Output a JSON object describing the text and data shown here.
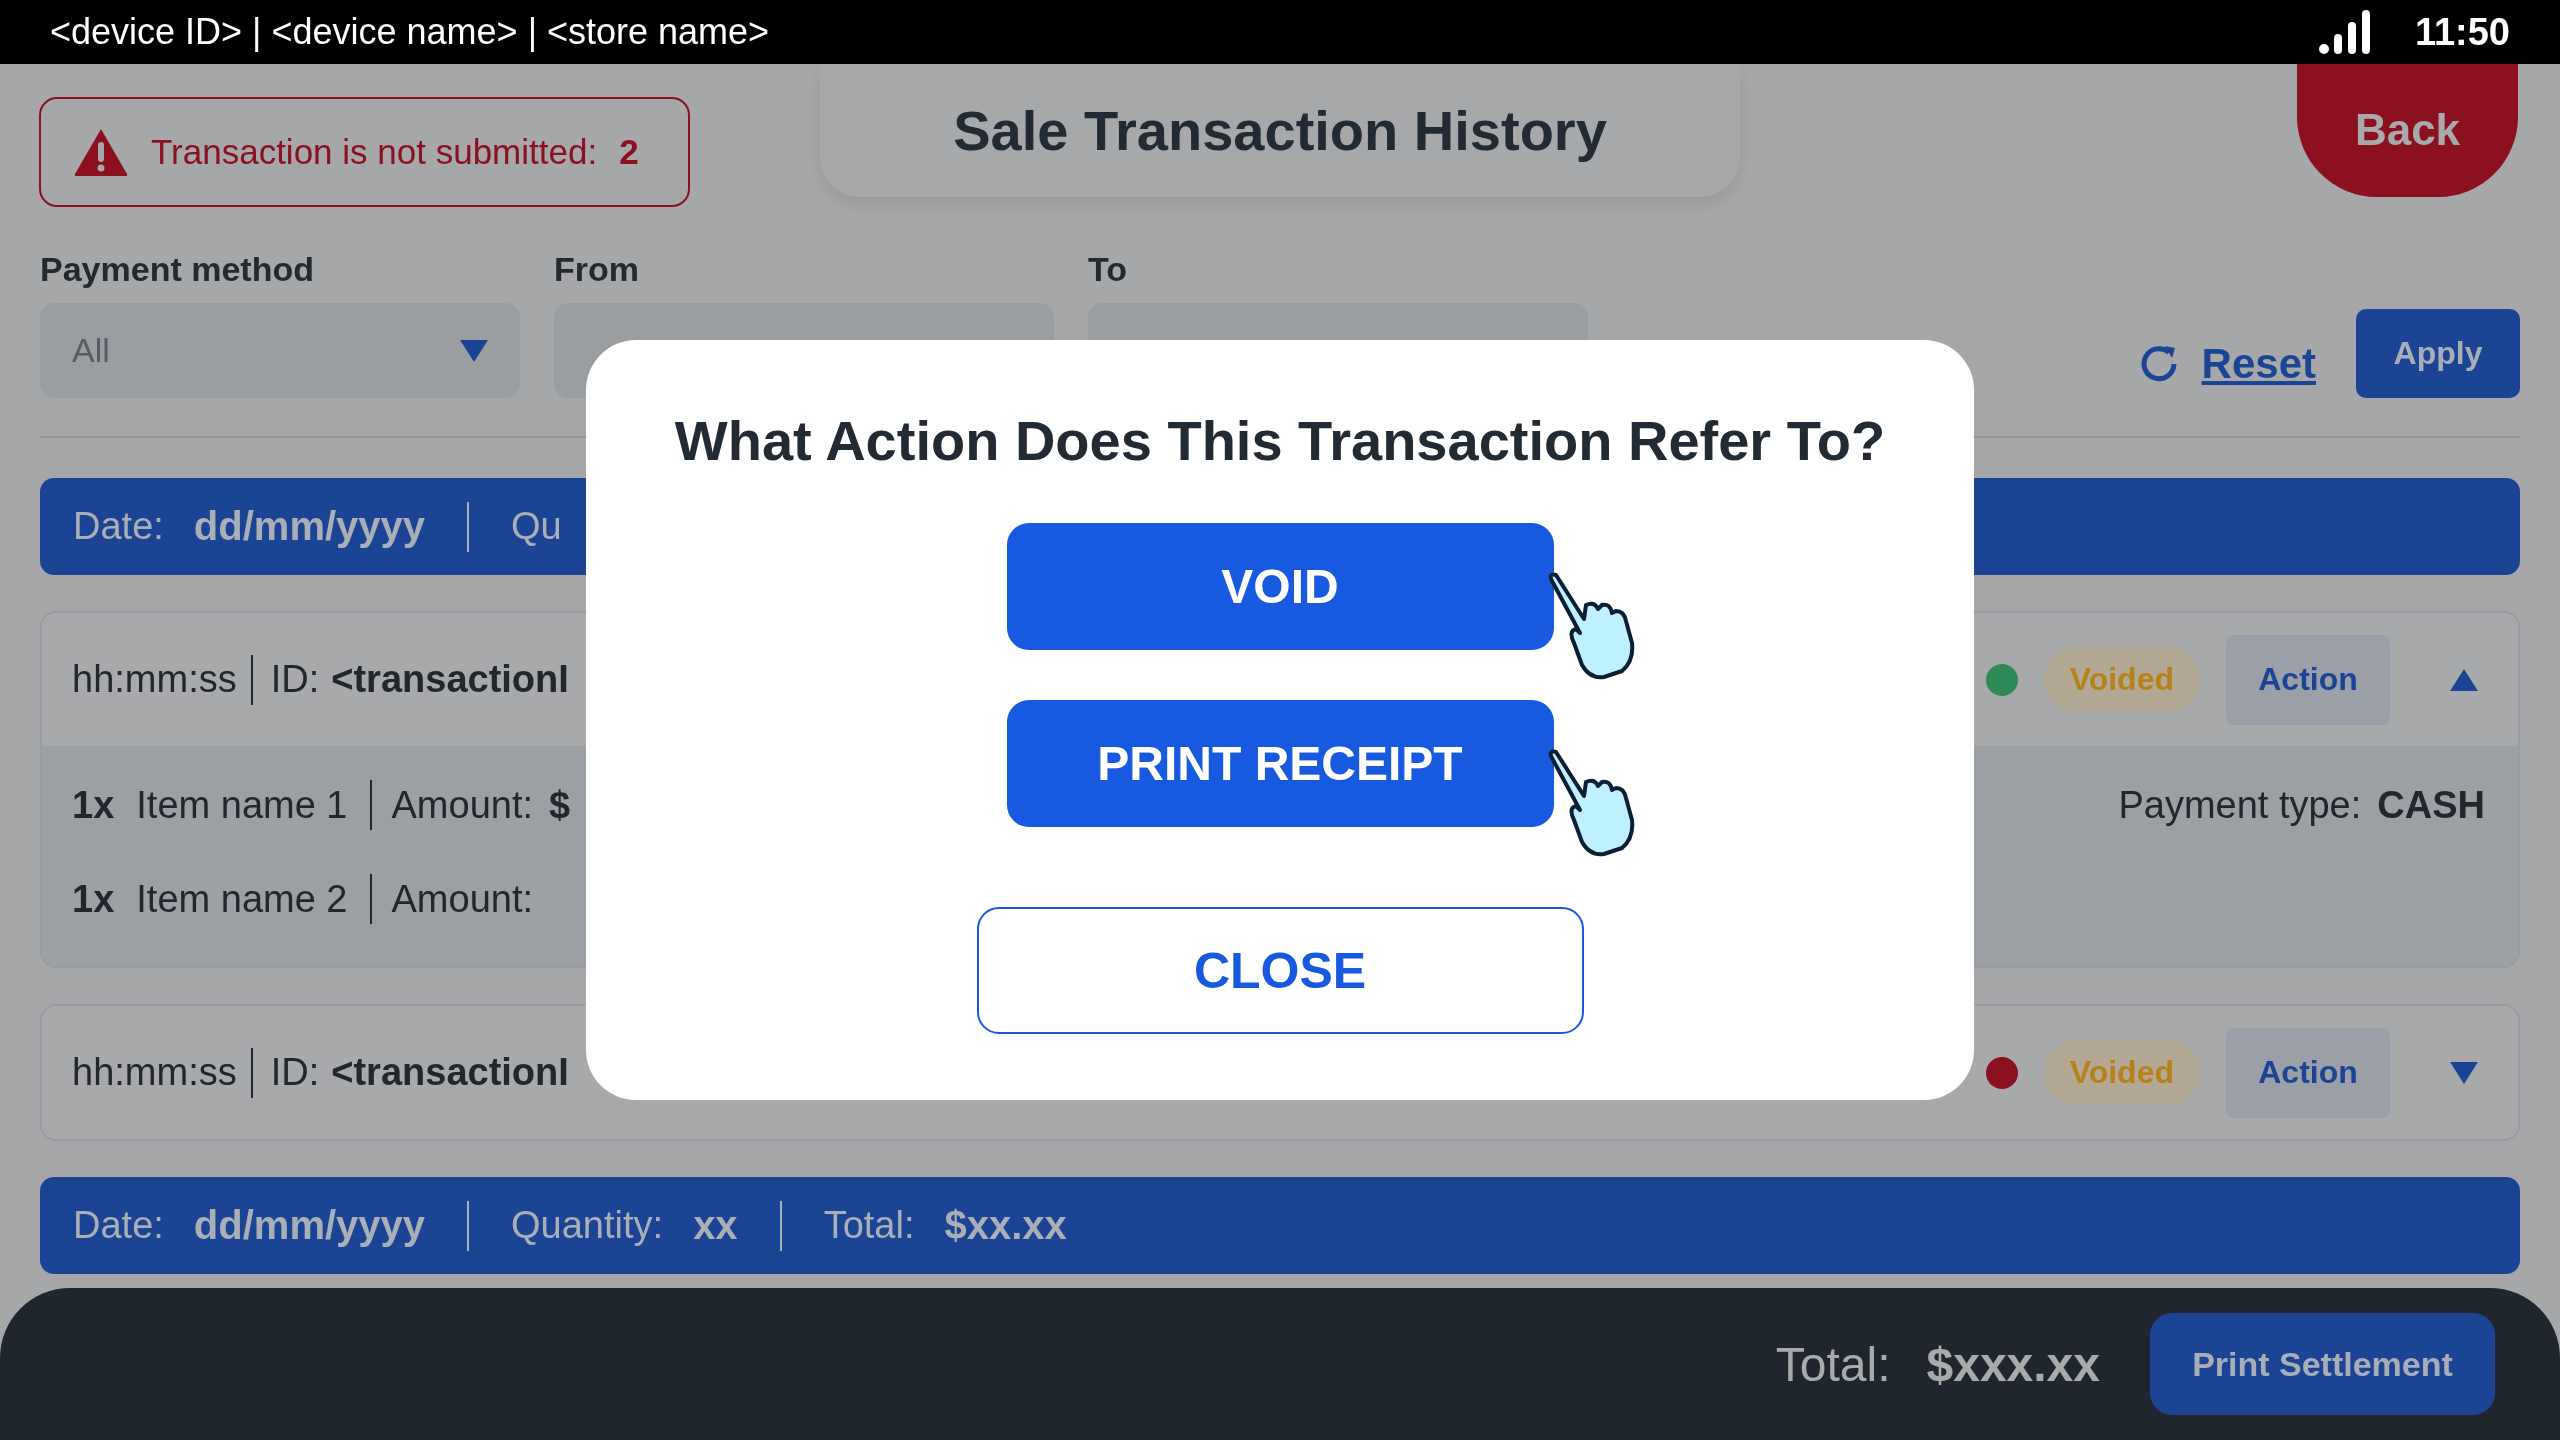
{
  "status_bar": {
    "device_info": "<device ID> | <device name> | <store name>",
    "time": "11:50"
  },
  "alert": {
    "text": "Transaction is not submitted:",
    "count": "2"
  },
  "title": "Sale Transaction History",
  "back_button": "Back",
  "filters": [
    {
      "label": "Payment method",
      "value": "All"
    },
    {
      "label": "From"
    },
    {
      "label": "To"
    }
  ],
  "reset": "Reset",
  "apply": "Apply",
  "sections": [
    {
      "date_bar": [
        {
          "label": "Date:",
          "value": "dd/mm/yyyy"
        },
        {
          "label": "Qu"
        }
      ],
      "transactions": [
        {
          "time": "hh:mm:ss",
          "id_label": "ID:",
          "id": "<transactionI",
          "color": "#2e8b57",
          "status": "Voided",
          "action": "Action",
          "expanded": true,
          "items": [
            {
              "qty": "1x",
              "name": "Item name 1",
              "amount_label": "Amount:",
              "amount": "$"
            },
            {
              "qty": "1x",
              "name": "Item name 2",
              "amount_label": "Amount:"
            }
          ],
          "payment_type_label": "Payment type:",
          "payment_type": "CASH"
        },
        {
          "time": "hh:mm:ss",
          "id_label": "ID:",
          "id": "<transactionI",
          "color": "#8b1020",
          "status": "Voided",
          "action": "Action",
          "expanded": false
        }
      ]
    },
    {
      "date_bar": [
        {
          "label": "Date:",
          "value": "dd/mm/yyyy"
        },
        {
          "label": "Quantity:",
          "value": "xx"
        },
        {
          "label": "Total:",
          "value": "$xx.xx"
        }
      ]
    }
  ],
  "footer": {
    "total_label": "Total:",
    "total": "$xxx.xx",
    "button": "Print Settlement"
  },
  "modal": {
    "title": "What Action Does This Transaction Refer To?",
    "actions": [
      "VOID",
      "PRINT RECEIPT"
    ],
    "close": "CLOSE"
  }
}
